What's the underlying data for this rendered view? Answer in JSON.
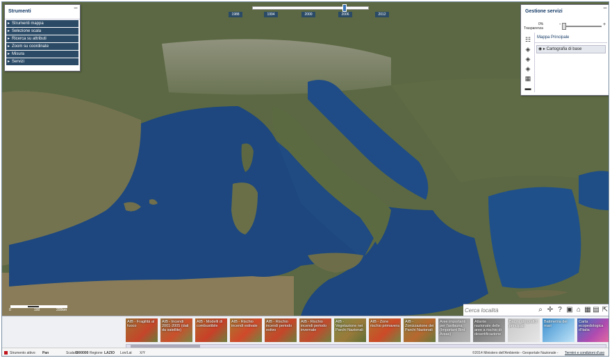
{
  "tools_panel": {
    "title": "Strumenti",
    "minimize": "−",
    "items": [
      "Strumenti mappa",
      "Selezione scala",
      "Ricerca su attributi",
      "Zoom su coordinate",
      "Misura",
      "Servizi"
    ]
  },
  "timeline": {
    "years": [
      "1988",
      "1994",
      "2000",
      "2006",
      "2012"
    ],
    "selected": "2006"
  },
  "services_panel": {
    "title": "Gestione servizi",
    "minimize": "−",
    "transparency_value": "0%",
    "transparency_label": "Trasparenza",
    "minus": "-",
    "plus": "+",
    "map_title": "Mappa Principale",
    "layer": "Cartografia di base"
  },
  "scale_bar": {
    "labels": [
      "0",
      "100",
      "200km"
    ]
  },
  "search": {
    "placeholder": "Cerca località"
  },
  "thumbnails": [
    "AIB - Fragilità al fuoco",
    "AIB - Incendi 2001-2005 (dati da satellite)",
    "AIB - Modelli di combustibile",
    "AIB - Rischio incendi estivale",
    "AIB - Rischio incendi periodo estivo",
    "AIB - Rischio incendi periodo invernale",
    "AIB - Vegetazione nei Parchi Nazionali",
    "AIB - Zone rischio primavera",
    "AIB - Zonizzazione dei Parchi Nazionali",
    "Aree importanti per l'avifauna (Important Bird Areas)",
    "Atlante nazionale delle aree a rischio di desertificazione",
    "Bacini idrografici principali",
    "Batimetria dei mari",
    "Carta ecopedologica d'Italia"
  ],
  "status": {
    "tool_label": "Strumento attivo:",
    "tool_value": "Pan",
    "scale_label": "Scala 1:",
    "scale_value": "6000000",
    "region_label": "Regione",
    "region_value": "LAZIO",
    "coord_system": "Lon/Lat",
    "coord_xy": "X/Y",
    "copyright": "©2014 Ministero dell'Ambiente - Geoportale Nazionale -",
    "terms": "Termini e condizioni d'uso"
  },
  "colors": {
    "panel_header": "#143a66",
    "menu_bg": "#2a4a66",
    "sea": "#1d477e",
    "land": "#5e6a45"
  }
}
